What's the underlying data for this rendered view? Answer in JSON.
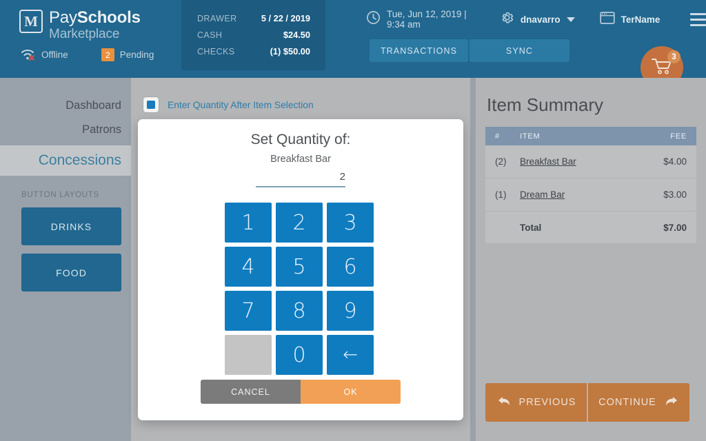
{
  "brand": {
    "logo_glyph": "M",
    "name_line1_light": "Pay",
    "name_line1_bold": "Schools",
    "name_line2": "Marketplace"
  },
  "status": {
    "offline_label": "Offline",
    "pending_count": "2",
    "pending_label": "Pending"
  },
  "drawer": {
    "rows": [
      {
        "key": "DRAWER",
        "value": "5 / 22 / 2019"
      },
      {
        "key": "CASH",
        "value": "$24.50"
      },
      {
        "key": "CHECKS",
        "value": "(1) $50.00"
      }
    ]
  },
  "header": {
    "datetime": "Tue, Jun 12, 2019 | 9:34 am",
    "username": "dnavarro",
    "terminal": "TerName",
    "tab_transactions": "TRANSACTIONS",
    "tab_sync": "SYNC",
    "cart_count": "3"
  },
  "sidebar": {
    "items": [
      {
        "label": "Dashboard"
      },
      {
        "label": "Patrons"
      },
      {
        "label": "Concessions"
      }
    ],
    "layouts_heading": "BUTTON LAYOUTS",
    "layout_buttons": [
      {
        "label": "DRINKS"
      },
      {
        "label": "FOOD"
      }
    ]
  },
  "content": {
    "qty_toggle_label": "Enter Quantity After Item Selection"
  },
  "modal": {
    "title": "Set Quantity of:",
    "item_name": "Breakfast Bar",
    "quantity_value": "2",
    "keys": [
      "1",
      "2",
      "3",
      "4",
      "5",
      "6",
      "7",
      "8",
      "9",
      "",
      "0",
      "←"
    ],
    "cancel_label": "CANCEL",
    "ok_label": "OK"
  },
  "summary": {
    "title": "Item Summary",
    "columns": {
      "num": "#",
      "item": "ITEM",
      "fee": "FEE"
    },
    "rows": [
      {
        "qty": "(2)",
        "item": "Breakfast Bar",
        "fee": "$4.00"
      },
      {
        "qty": "(1)",
        "item": "Dream Bar",
        "fee": "$3.00"
      }
    ],
    "total_label": "Total",
    "total_value": "$7.00",
    "previous_label": "PREVIOUS",
    "continue_label": "CONTINUE"
  },
  "colors": {
    "header_blue": "#21678f",
    "drawer_blue": "#1d5b80",
    "key_blue": "#0f7cc0",
    "accent_orange": "#f2a055",
    "cart_orange": "#c4713f",
    "footer_brown": "#c0793f",
    "sidebar_gray": "#99a1ab",
    "table_head": "#7d94ac"
  }
}
